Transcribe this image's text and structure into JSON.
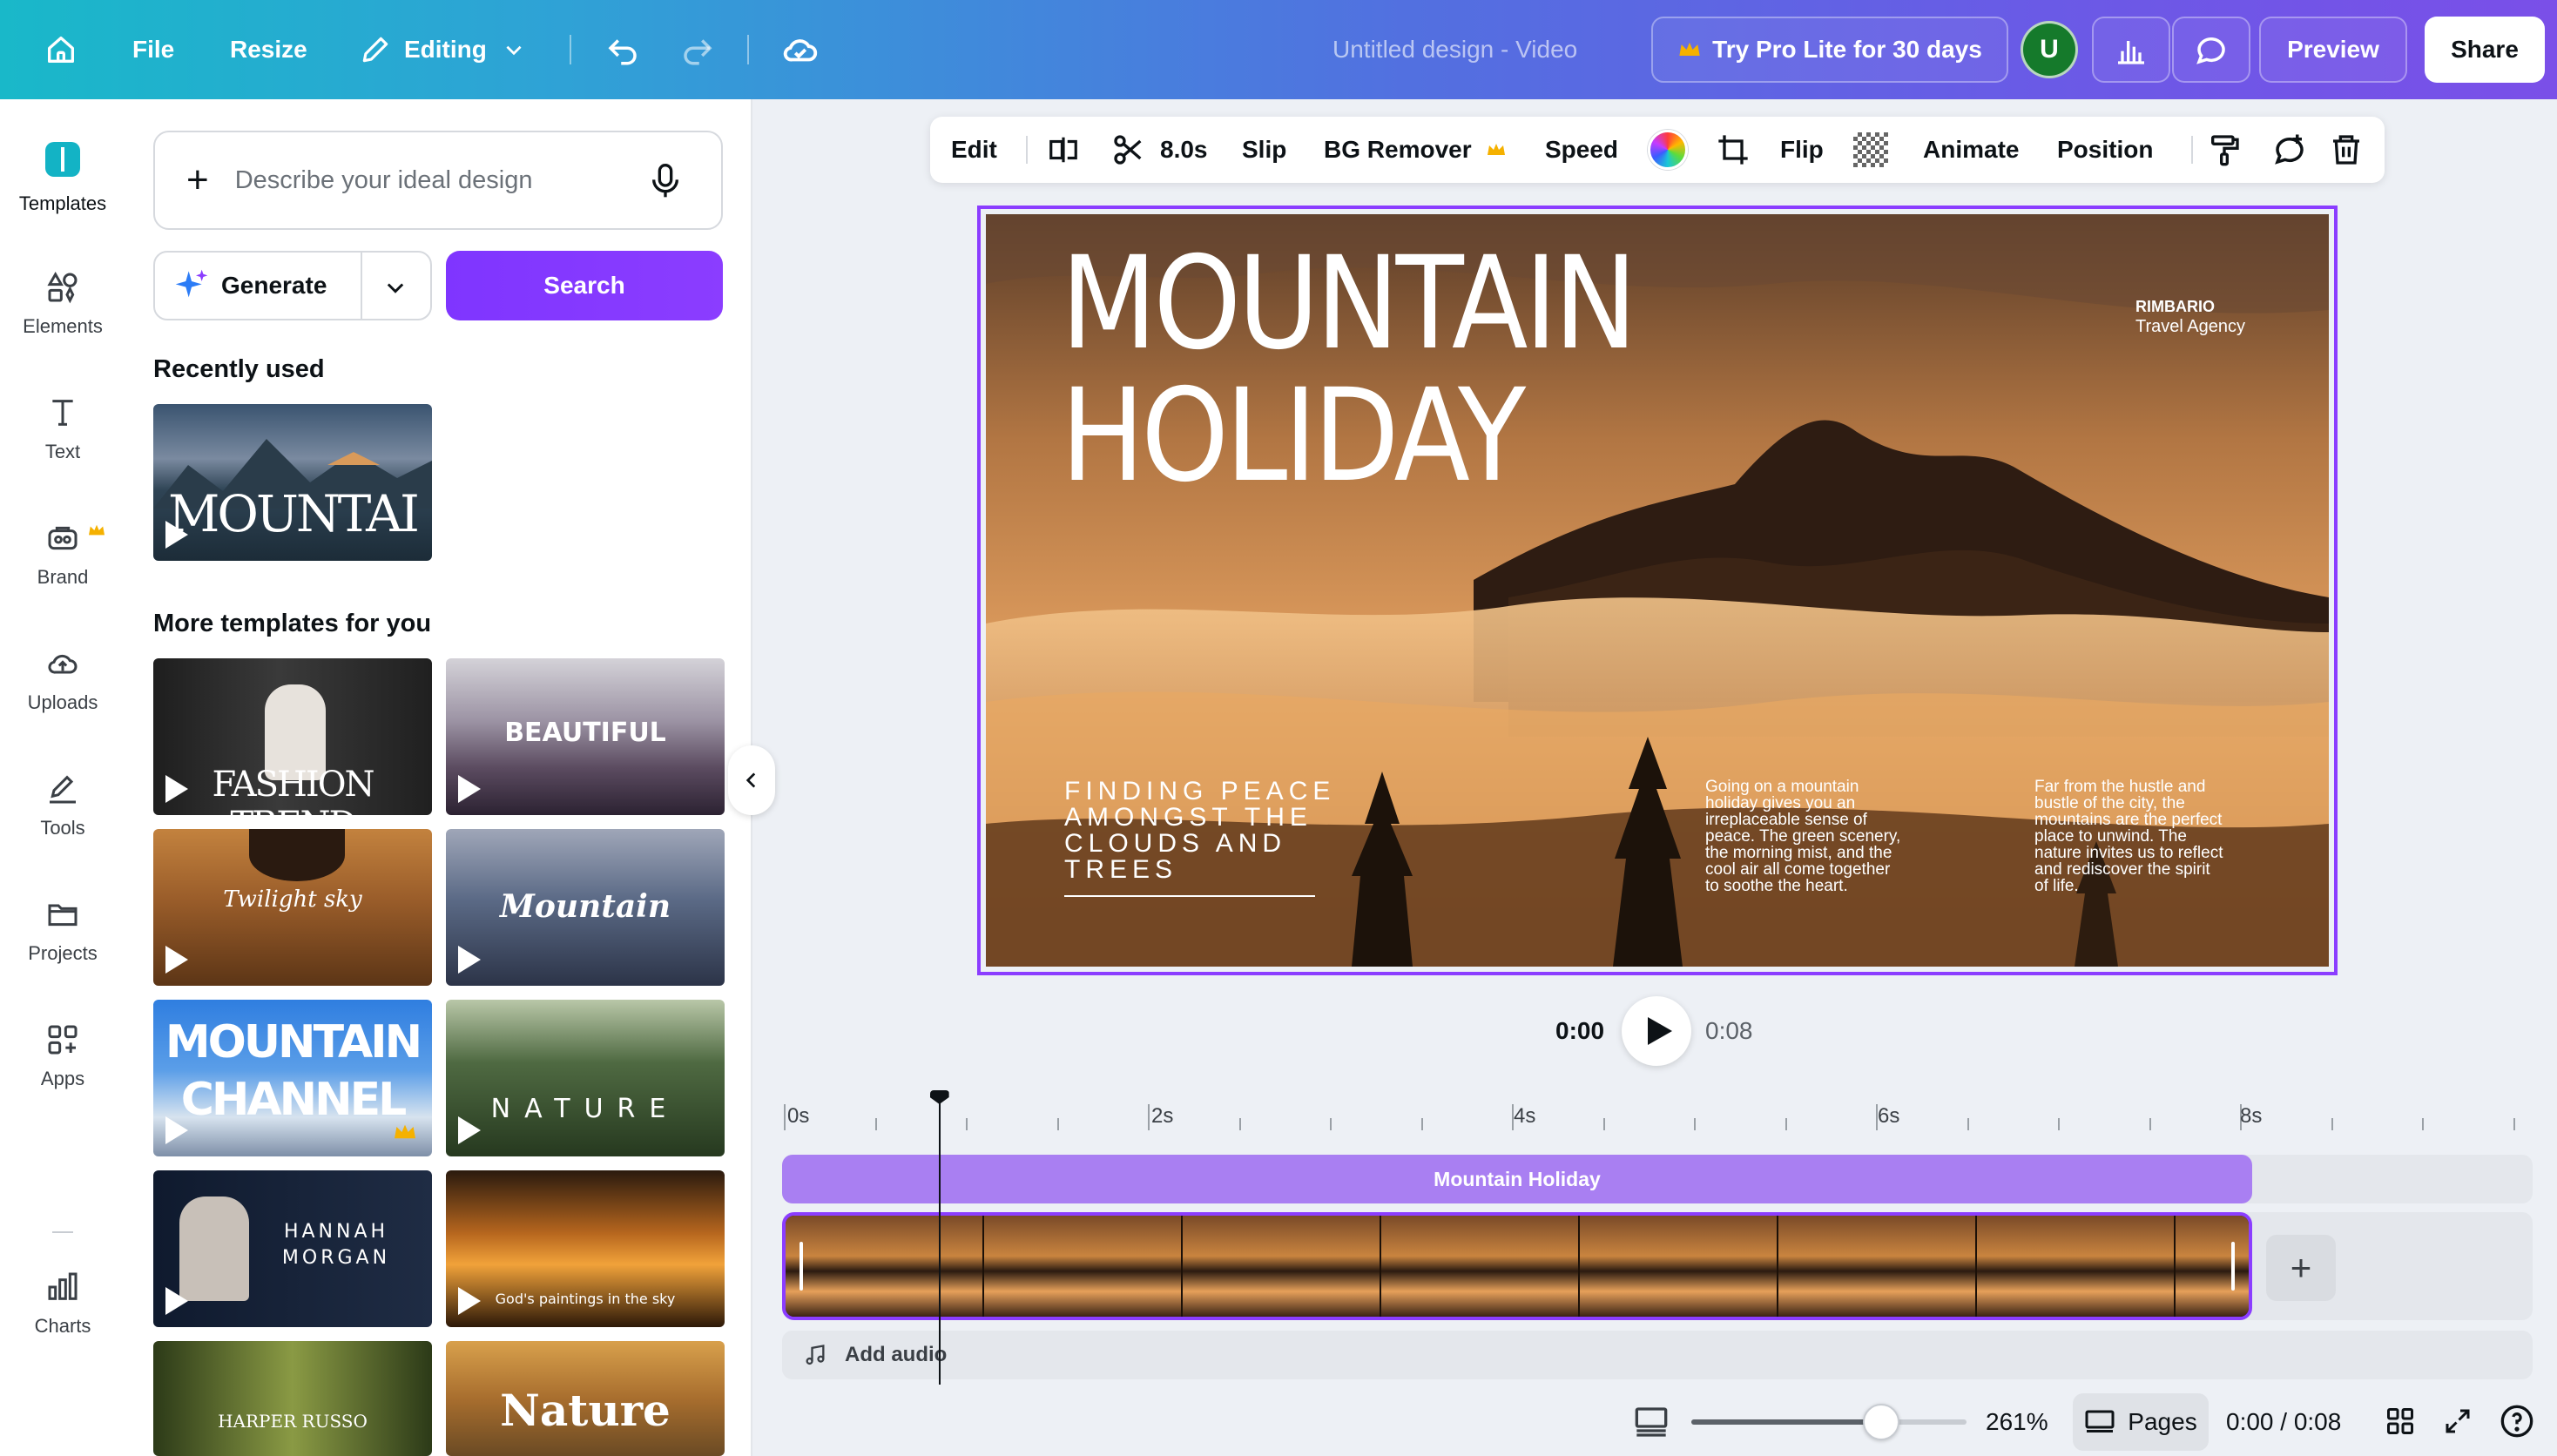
{
  "topbar": {
    "file": "File",
    "resize": "Resize",
    "editing": "Editing",
    "doc_title": "Untitled design - Video",
    "try_pro": "Try Pro Lite for 30 days",
    "avatar_initial": "U",
    "preview": "Preview",
    "share": "Share"
  },
  "rail": {
    "items": [
      {
        "label": "Templates",
        "icon": "templates-icon"
      },
      {
        "label": "Elements",
        "icon": "elements-icon"
      },
      {
        "label": "Text",
        "icon": "text-icon"
      },
      {
        "label": "Brand",
        "icon": "brand-icon"
      },
      {
        "label": "Uploads",
        "icon": "uploads-icon"
      },
      {
        "label": "Tools",
        "icon": "tools-icon"
      },
      {
        "label": "Projects",
        "icon": "projects-icon"
      },
      {
        "label": "Apps",
        "icon": "apps-icon"
      },
      {
        "label": "Charts",
        "icon": "charts-icon"
      }
    ]
  },
  "panel": {
    "describe_placeholder": "Describe your ideal design",
    "generate": "Generate",
    "search": "Search",
    "recently_used": "Recently used",
    "more_templates": "More templates for you",
    "recent_thumb_title": "MOUNTAI",
    "templates": [
      {
        "title": "FASHION TREND"
      },
      {
        "title": "BEAUTIFUL"
      },
      {
        "title": "Twilight sky"
      },
      {
        "title": "Mountain"
      },
      {
        "title": "MOUNTAIN CHANNEL"
      },
      {
        "title": "NATURE"
      },
      {
        "title": "HANNAH MORGAN"
      },
      {
        "title": "God's paintings in the sky"
      },
      {
        "title": "HARPER RUSSO"
      },
      {
        "title": "Nature"
      }
    ]
  },
  "context_toolbar": {
    "edit": "Edit",
    "duration": "8.0s",
    "slip": "Slip",
    "bg_remover": "BG Remover",
    "speed": "Speed",
    "flip": "Flip",
    "animate": "Animate",
    "position": "Position"
  },
  "slide": {
    "title_line1": "MOUNTAIN",
    "title_line2": "HOLIDAY",
    "brand_name": "RIMBARIO",
    "brand_sub": "Travel Agency",
    "finding": [
      "FINDING PEACE",
      "AMONGST THE",
      "CLOUDS AND",
      "TREES"
    ],
    "para1": [
      "Going on a mountain",
      "holiday gives you an",
      "irreplaceable sense of",
      "peace. The green scenery,",
      "the morning mist, and the",
      "cool air all come together",
      "to soothe the heart."
    ],
    "para2": [
      "Far from the hustle and",
      "bustle of the city, the",
      "mountains are the perfect",
      "place to unwind. The",
      "nature invites us to reflect",
      "and rediscover the spirit",
      "of life."
    ]
  },
  "player": {
    "current": "0:00",
    "total": "0:08"
  },
  "timeline": {
    "ticks": [
      "0s",
      "2s",
      "4s",
      "6s",
      "8s"
    ],
    "text_track": "Mountain Holiday",
    "add_audio": "Add audio",
    "playhead_seconds": 0.85
  },
  "bottombar": {
    "zoom": "261%",
    "zoom_fraction": 0.69,
    "pages": "Pages",
    "time": "0:00 / 0:08"
  },
  "colors": {
    "accent": "#8b3dff",
    "gradient_start": "#19b8c9",
    "gradient_end": "#7a4fe8",
    "pro_crown": "#f5b100"
  }
}
